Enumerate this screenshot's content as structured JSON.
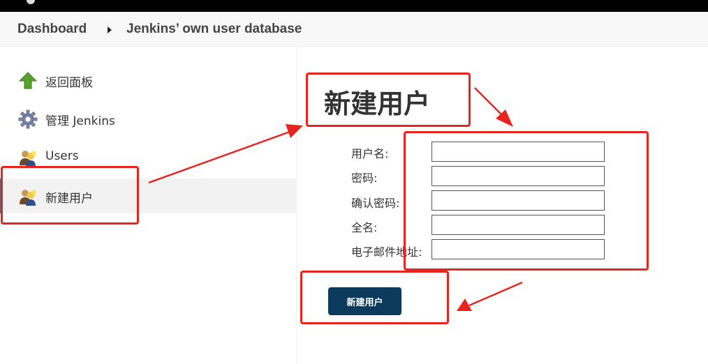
{
  "breadcrumb": {
    "items": [
      "Dashboard",
      "Jenkins’ own user database"
    ]
  },
  "sidebar": {
    "items": [
      {
        "label": "返回面板",
        "icon": "up-arrow-icon"
      },
      {
        "label": "管理 Jenkins",
        "icon": "gear-icon"
      },
      {
        "label": "Users",
        "icon": "users-icon"
      },
      {
        "label": "新建用户",
        "icon": "users-icon",
        "active": true
      }
    ]
  },
  "main": {
    "title": "新建用户",
    "fields": [
      {
        "label": "用户名:",
        "value": ""
      },
      {
        "label": "密码:",
        "value": ""
      },
      {
        "label": "确认密码:",
        "value": ""
      },
      {
        "label": "全名:",
        "value": ""
      },
      {
        "label": "电子邮件地址:",
        "value": ""
      }
    ],
    "submit_label": "新建用户"
  },
  "colors": {
    "annotation": "#e8241e",
    "submit_bg": "#0b3a5c",
    "active_bg": "#f2f2f2"
  }
}
